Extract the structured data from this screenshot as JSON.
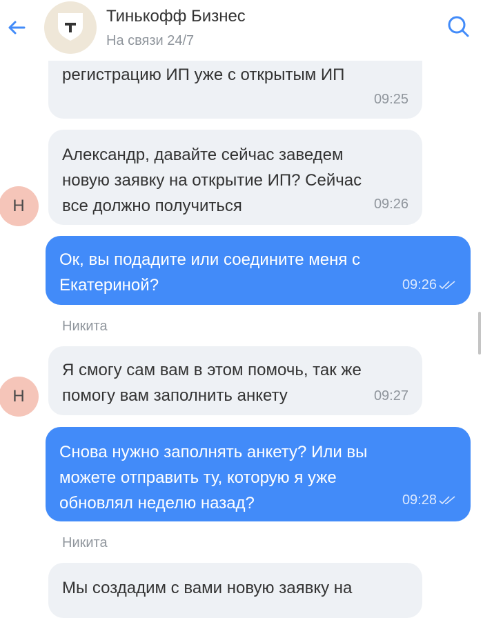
{
  "header": {
    "title": "Тинькофф Бизнес",
    "subtitle": "На связи 24/7"
  },
  "colors": {
    "accent": "#428bf9",
    "incoming_bubble": "#eef1f5",
    "avatar_bg": "#f5c5b9",
    "logo_bg": "#efe7d8"
  },
  "messages": [
    {
      "direction": "incoming",
      "lines": [
        "регистрацию ИП уже с открытым ИП"
      ],
      "time": "09:25"
    },
    {
      "direction": "incoming",
      "avatar": "Н",
      "lines": [
        "Александр, давайте сейчас заведем",
        "новую заявку на открытие ИП? Сейчас",
        "все должно получиться"
      ],
      "time": "09:26"
    },
    {
      "direction": "outgoing",
      "lines": [
        "Ок, вы подадите или соедините меня с",
        "Екатериной?"
      ],
      "time": "09:26",
      "status": "read"
    },
    {
      "sender": "Никита"
    },
    {
      "direction": "incoming",
      "avatar": "Н",
      "lines": [
        "Я смогу сам вам в этом помочь, так же",
        "помогу вам заполнить анкету"
      ],
      "time": "09:27"
    },
    {
      "direction": "outgoing",
      "lines": [
        "Снова нужно заполнять анкету? Или вы",
        "можете отправить ту, которую я уже",
        "обновлял неделю назад?"
      ],
      "time": "09:28",
      "status": "read"
    },
    {
      "sender": "Никита"
    },
    {
      "direction": "incoming",
      "lines": [
        "Мы создадим с вами новую заявку на"
      ]
    }
  ]
}
